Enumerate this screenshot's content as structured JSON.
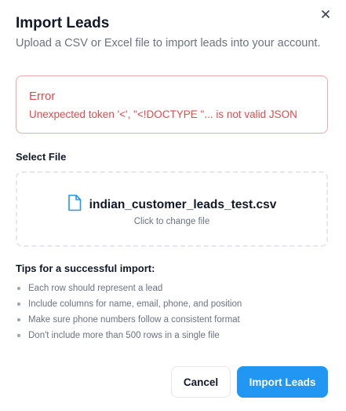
{
  "dialog": {
    "title": "Import Leads",
    "subtitle": "Upload a CSV or Excel file to import leads into your account.",
    "close_icon": "close-icon"
  },
  "error": {
    "title": "Error",
    "message": "Unexpected token '<', \"<!DOCTYPE \"... is not valid JSON",
    "color": "#e5484d",
    "border_color": "#f1a7a7"
  },
  "file_section": {
    "label": "Select File",
    "file_icon": "file-icon",
    "file_name": "indian_customer_leads_test.csv",
    "hint": "Click to change file"
  },
  "tips": {
    "title": "Tips for a successful import:",
    "items": [
      "Each row should represent a lead",
      "Include columns for name, email, phone, and position",
      "Make sure phone numbers follow a consistent format",
      "Don't include more than 500 rows in a single file"
    ]
  },
  "actions": {
    "cancel_label": "Cancel",
    "import_label": "Import Leads",
    "accent_color": "#2196f3"
  }
}
